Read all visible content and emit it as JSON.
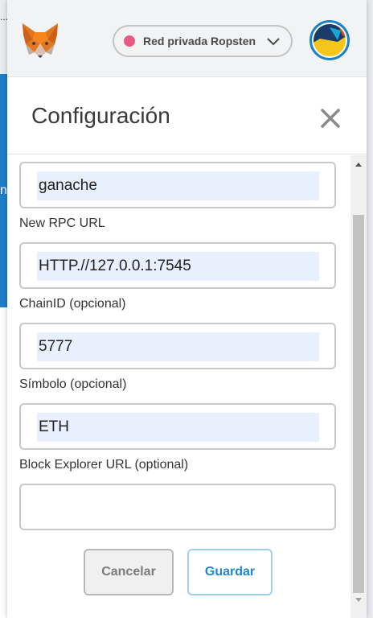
{
  "background": {
    "left_text": "n",
    "left_dots": "..."
  },
  "topbar": {
    "logo": "metamask-fox-icon",
    "network_label": "Red privada Ropsten",
    "network_dot_color": "#e95a83",
    "account_avatar": "account-identicon"
  },
  "header": {
    "title": "Configuración",
    "close_icon": "close-icon"
  },
  "form": {
    "network_name_value": "ganache",
    "rpc_url_label": "New RPC URL",
    "rpc_url_value": "HTTP.//127.0.0.1:7545",
    "chain_id_label": "ChainID (opcional)",
    "chain_id_value": "5777",
    "symbol_label": "Símbolo (opcional)",
    "symbol_value": "ETH",
    "explorer_label": "Block Explorer URL (optional)",
    "explorer_value": ""
  },
  "buttons": {
    "cancel": "Cancelar",
    "save": "Guardar"
  },
  "colors": {
    "accent": "#1f86d1",
    "autofill": "#e8f0fe"
  }
}
